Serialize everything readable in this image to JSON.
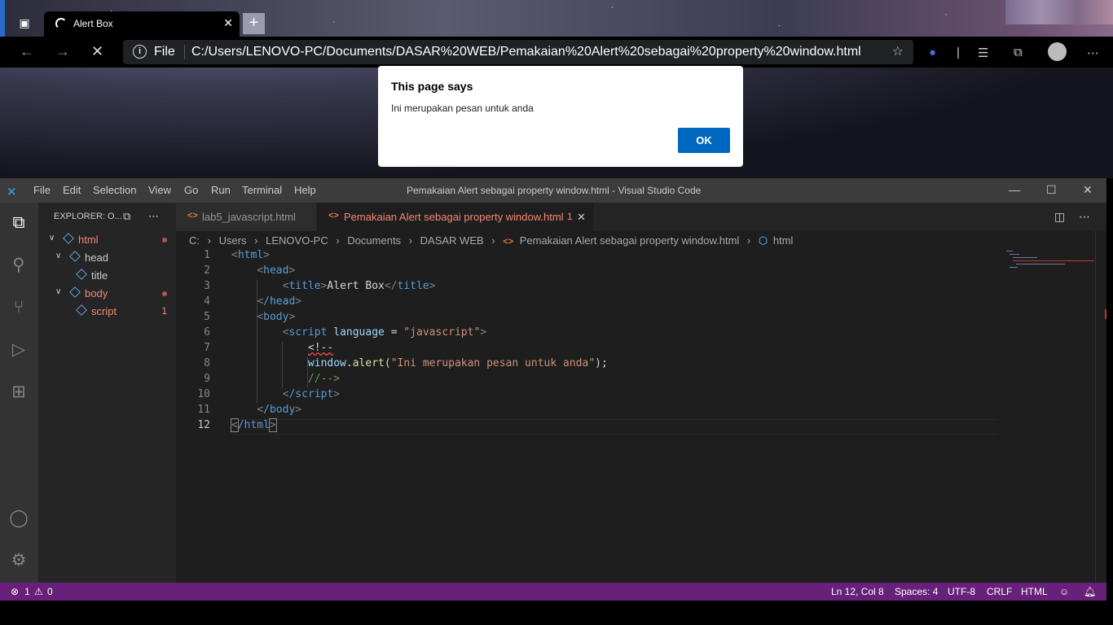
{
  "browser": {
    "tab_title": "Alert Box",
    "new_tab_glyph": "+",
    "scheme": "File",
    "url": "C:/Users/LENOVO-PC/Documents/DASAR%20WEB/Pemakaian%20Alert%20sebagai%20property%20window.html"
  },
  "dialog": {
    "heading": "This page says",
    "message": "Ini merupakan pesan untuk anda",
    "ok_label": "OK"
  },
  "vscode": {
    "menu": [
      "File",
      "Edit",
      "Selection",
      "View",
      "Go",
      "Run",
      "Terminal",
      "Help"
    ],
    "window_title": "Pemakaian Alert sebagai property window.html - Visual Studio Code",
    "explorer_title": "EXPLORER: O...",
    "outline": [
      {
        "label": "html",
        "badge": "dot"
      },
      {
        "label": "head"
      },
      {
        "label": "title"
      },
      {
        "label": "body",
        "badge": "dot"
      },
      {
        "label": "script",
        "badge": "1"
      }
    ],
    "tabs": [
      {
        "label": "lab5_javascript.html",
        "active": false
      },
      {
        "label": "Pemakaian Alert sebagai property window.html",
        "count": "1",
        "active": true
      }
    ],
    "breadcrumb": [
      "C:",
      "Users",
      "LENOVO-PC",
      "Documents",
      "DASAR WEB",
      "Pemakaian Alert sebagai property window.html",
      "html"
    ],
    "line_numbers": [
      "1",
      "2",
      "3",
      "4",
      "5",
      "6",
      "7",
      "8",
      "9",
      "10",
      "11",
      "12"
    ],
    "code": {
      "l1_tag": "html",
      "l2_tag": "head",
      "l3_tag": "title",
      "l3_text": "Alert Box",
      "l4_tag": "/head",
      "l5_tag": "body",
      "l6_tag": "script",
      "l6_attr": "language",
      "l6_eq": " = ",
      "l6_val": "\"javascript\"",
      "l7": "<!--",
      "l8_obj": "window",
      "l8_fn": "alert",
      "l8_str": "\"Ini merupakan pesan untuk anda\"",
      "l9": "//-->",
      "l10_tag": "/script",
      "l11_tag": "/body",
      "l12_tag": "/html"
    },
    "status": {
      "errors": "1",
      "warnings": "0",
      "position": "Ln 12, Col 8",
      "spaces": "Spaces: 4",
      "encoding": "UTF-8",
      "eol": "CRLF",
      "language": "HTML"
    },
    "colors": {
      "status_bar": "#68217a",
      "accent": "#007acc",
      "error": "#f48771"
    }
  }
}
